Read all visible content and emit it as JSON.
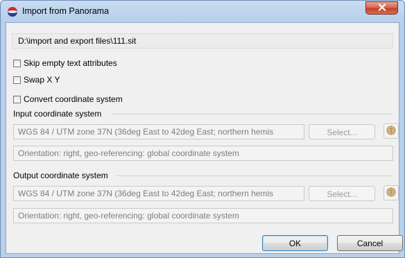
{
  "window": {
    "title": "Import from Panorama",
    "app_icon": "panorama-globe-icon",
    "close_icon": "close-x-icon"
  },
  "path": {
    "value": "D:\\import and export files\\111.sit"
  },
  "options": [
    {
      "label": "Skip empty text attributes",
      "checked": false
    },
    {
      "label": "Swap X Y",
      "checked": false
    },
    {
      "label": "Convert coordinate system",
      "checked": false
    }
  ],
  "input_cs": {
    "label": "Input coordinate system",
    "value": "WGS 84 / UTM zone 37N (36deg East to 42deg East; northern hemis",
    "select_label": "Select...",
    "orientation": "Orientation: right, geo-referencing: global coordinate system"
  },
  "output_cs": {
    "label": "Output coordinate system",
    "value": "WGS 84 / UTM zone 37N (36deg East to 42deg East; northern hemis",
    "select_label": "Select...",
    "orientation": "Orientation: right, geo-referencing: global coordinate system"
  },
  "buttons": {
    "ok": "OK",
    "cancel": "Cancel"
  },
  "colors": {
    "title_bar": "#b9d0ea",
    "close_button": "#c4402a",
    "dialog_background": "#f0f0f0",
    "disabled_text": "#7d7d7d"
  }
}
